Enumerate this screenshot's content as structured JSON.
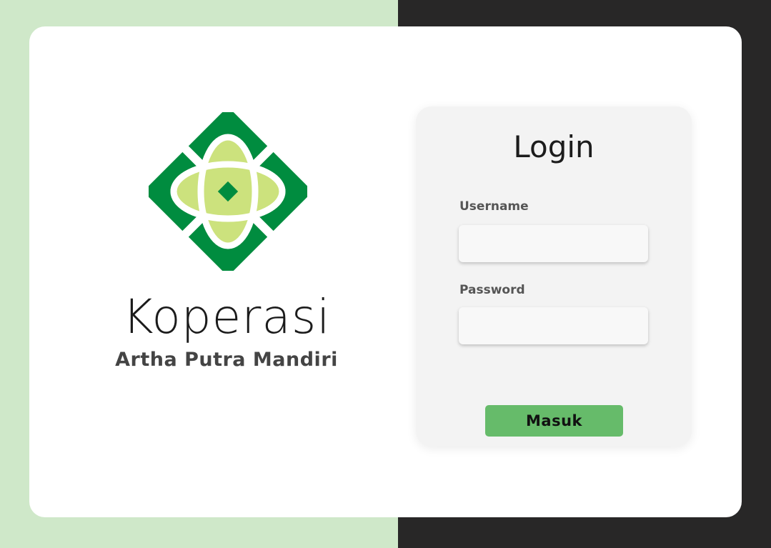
{
  "brand": {
    "title": "Koperasi",
    "subtitle": "Artha Putra Mandiri",
    "logo_icon": "koperasi-logo-icon",
    "logo_colors": {
      "dark_green": "#008c3f",
      "light_green": "#cce27d",
      "white_ring": "#ffffff"
    }
  },
  "login": {
    "title": "Login",
    "username": {
      "label": "Username",
      "value": "",
      "placeholder": ""
    },
    "password": {
      "label": "Password",
      "value": "",
      "placeholder": ""
    },
    "submit_label": "Masuk"
  },
  "colors": {
    "left_background": "#cfe8c9",
    "right_background": "#282727",
    "card": "#ffffff",
    "panel": "#f3f3f3",
    "button": "#66bb6a"
  }
}
